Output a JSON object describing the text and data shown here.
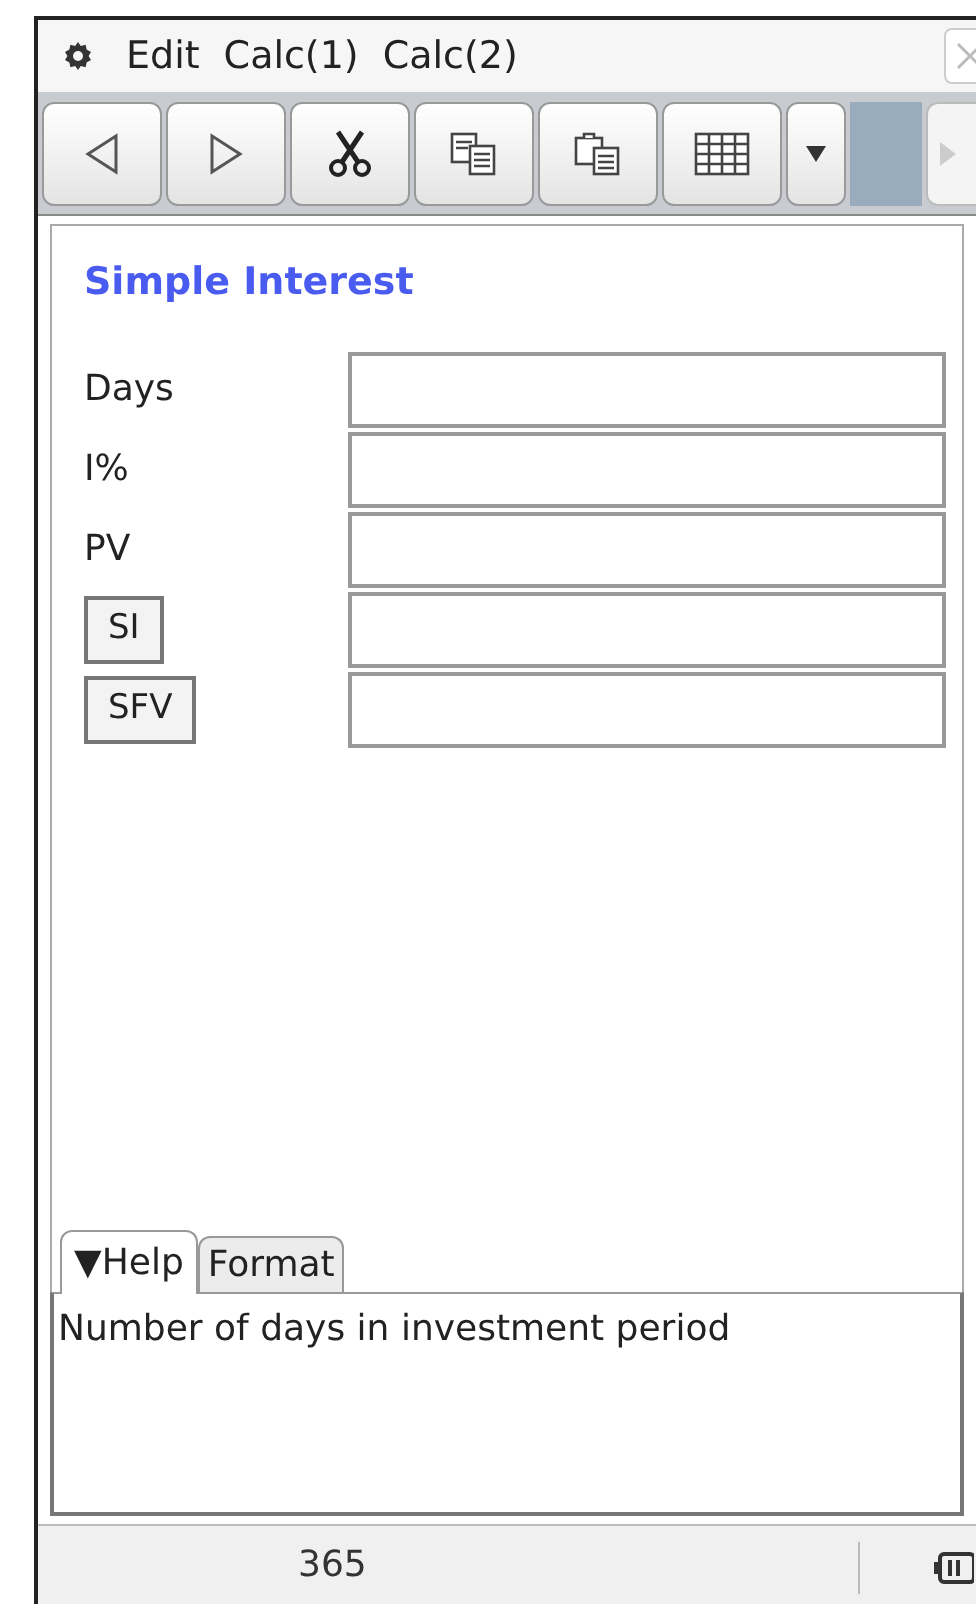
{
  "menu_bar": {
    "items": [
      "Edit",
      "Calc(1)",
      "Calc(2)"
    ]
  },
  "form": {
    "title": "Simple Interest",
    "rows": [
      {
        "kind": "label",
        "label": "Days"
      },
      {
        "kind": "label",
        "label": "I%"
      },
      {
        "kind": "label",
        "label": "PV"
      },
      {
        "kind": "button",
        "label": "SI"
      },
      {
        "kind": "button",
        "label": "SFV"
      }
    ]
  },
  "tabs": [
    {
      "label": "▼Help",
      "selected": true
    },
    {
      "label": "Format",
      "selected": false
    }
  ],
  "help_text": "Number of days in investment period",
  "status_bar": {
    "value": "365"
  }
}
